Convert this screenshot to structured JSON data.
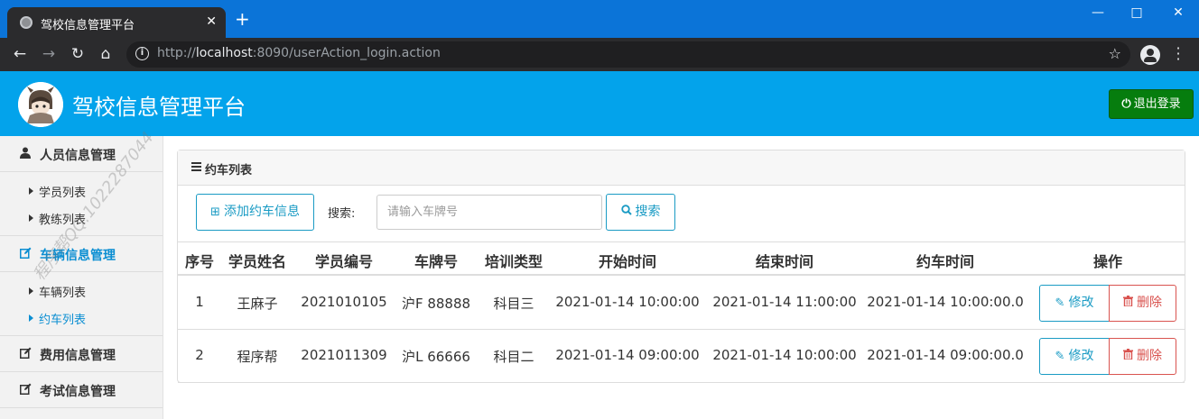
{
  "browser": {
    "tab_title": "驾校信息管理平台",
    "tab_close": "✕",
    "new_tab": "+",
    "url_prefix": "http://",
    "url_host": "localhost",
    "url_rest": ":8090/userAction_login.action",
    "icons": [
      "back-icon",
      "forward-icon",
      "reload-icon",
      "home-icon",
      "info-icon",
      "star-icon",
      "profile-icon",
      "menu-icon"
    ]
  },
  "header": {
    "title": "驾校信息管理平台",
    "logout_label": "退出登录",
    "colors": {
      "bar": "#03a3eb",
      "logout": "#067d0e"
    }
  },
  "sidebar": {
    "groups": [
      {
        "label": "人员信息管理",
        "icon": "user-icon",
        "items": [
          {
            "label": "学员列表"
          },
          {
            "label": "教练列表"
          }
        ]
      },
      {
        "label": "车辆信息管理",
        "icon": "edit-icon",
        "active": true,
        "items": [
          {
            "label": "车辆列表"
          },
          {
            "label": "约车列表",
            "active": true
          }
        ]
      },
      {
        "label": "费用信息管理",
        "icon": "edit-icon"
      },
      {
        "label": "考试信息管理",
        "icon": "edit-icon"
      }
    ],
    "watermark": "程序帮QQ:1022287044"
  },
  "panel": {
    "title": "约车列表",
    "add_label": "添加约车信息",
    "search_label": "搜索:",
    "search_placeholder": "请输入车牌号",
    "search_button": "搜索"
  },
  "table": {
    "headers": [
      "序号",
      "学员姓名",
      "学员编号",
      "车牌号",
      "培训类型",
      "开始时间",
      "结束时间",
      "约车时间",
      "操作"
    ],
    "rows": [
      {
        "no": "1",
        "name": "王麻子",
        "student_id": "2021010105",
        "plate": "沪F 88888",
        "type": "科目三",
        "start": "2021-01-14 10:00:00",
        "end": "2021-01-14 11:00:00",
        "booked": "2021-01-14 10:00:00.0"
      },
      {
        "no": "2",
        "name": "程序帮",
        "student_id": "2021011309",
        "plate": "沪L 66666",
        "type": "科目二",
        "start": "2021-01-14 09:00:00",
        "end": "2021-01-14 10:00:00",
        "booked": "2021-01-14 09:00:00.0"
      }
    ],
    "edit_label": "修改",
    "delete_label": "删除"
  }
}
